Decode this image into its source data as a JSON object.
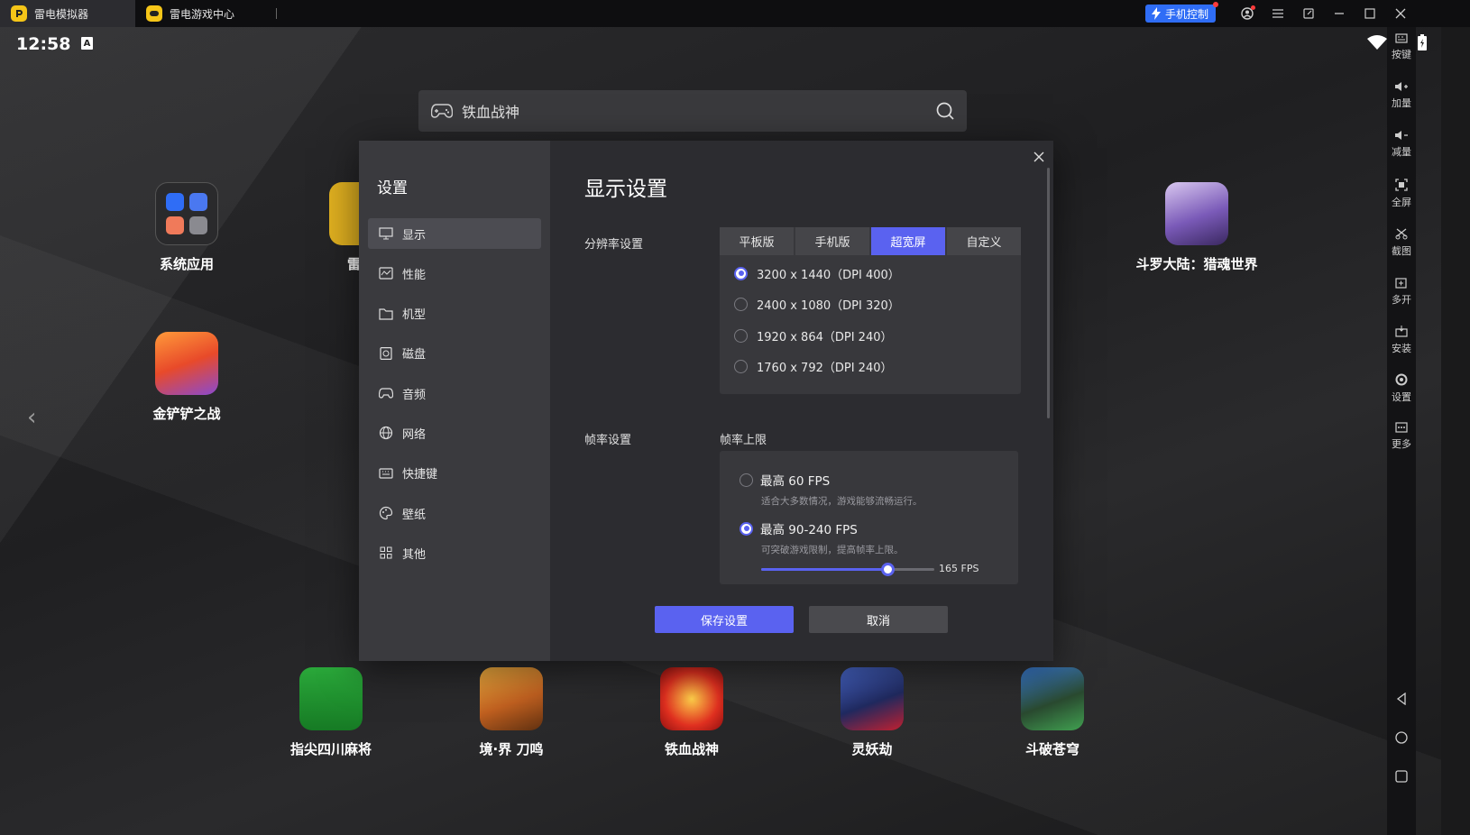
{
  "titlebar": {
    "tabs": [
      {
        "label": "雷电模拟器",
        "active": true
      },
      {
        "label": "雷电游戏中心",
        "active": false
      }
    ],
    "phone_control": "手机控制"
  },
  "status": {
    "time": "12:58",
    "input_badge": "A"
  },
  "search": {
    "value": "铁血战神"
  },
  "desktop_apps": [
    {
      "label": "系统应用"
    },
    {
      "label": "雷"
    },
    {
      "label": "斗罗大陆：猎魂世界"
    },
    {
      "label": "金铲铲之战"
    }
  ],
  "dock_apps": [
    {
      "label": "指尖四川麻将"
    },
    {
      "label": "境·界 刀鸣"
    },
    {
      "label": "铁血战神"
    },
    {
      "label": "灵妖劫"
    },
    {
      "label": "斗破苍穹"
    }
  ],
  "right_sidebar": [
    "按键",
    "加量",
    "减量",
    "全屏",
    "截图",
    "多开",
    "安装",
    "设置",
    "更多"
  ],
  "settings": {
    "title": "设置",
    "menu": [
      "显示",
      "性能",
      "机型",
      "磁盘",
      "音频",
      "网络",
      "快捷键",
      "壁纸",
      "其他"
    ],
    "active_menu": "显示",
    "section_title": "显示设置",
    "resolution_label": "分辨率设置",
    "resolution_tabs": [
      "平板版",
      "手机版",
      "超宽屏",
      "自定义"
    ],
    "resolution_active_tab": "超宽屏",
    "resolutions": [
      {
        "label": "3200 x 1440（DPI 400）",
        "selected": true
      },
      {
        "label": "2400 x 1080（DPI 320）",
        "selected": false
      },
      {
        "label": "1920 x 864（DPI 240）",
        "selected": false
      },
      {
        "label": "1760 x 792（DPI 240）",
        "selected": false
      }
    ],
    "fps_label": "帧率设置",
    "fps_limit_label": "帧率上限",
    "fps_options": [
      {
        "label": "最高 60 FPS",
        "desc": "适合大多数情况，游戏能够流畅运行。",
        "selected": false
      },
      {
        "label": "最高 90-240 FPS",
        "desc": "可突破游戏限制，提高帧率上限。",
        "selected": true
      }
    ],
    "fps_slider_value": "165 FPS",
    "fps_slider_fraction": 0.73,
    "save_button": "保存设置",
    "cancel_button": "取消"
  },
  "colors": {
    "accent": "#5a62f0",
    "phone_control": "#2f6df6",
    "brand": "#f5c518"
  }
}
